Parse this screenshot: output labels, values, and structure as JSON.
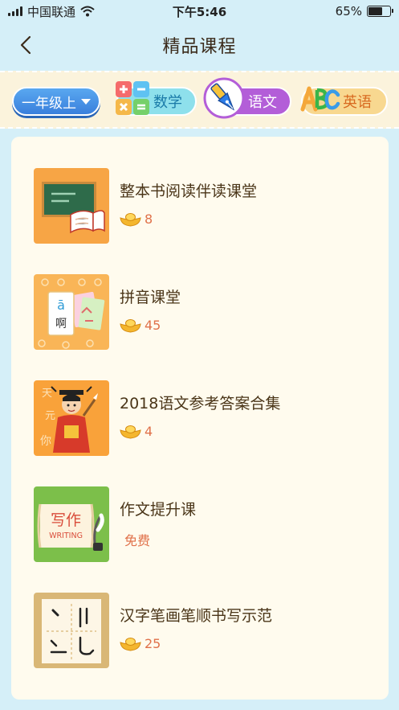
{
  "status_bar": {
    "carrier": "中国联通",
    "time": "下午5:46",
    "battery_percent": "65%",
    "battery_level": 0.65
  },
  "nav": {
    "title": "精品课程"
  },
  "subject_bar": {
    "grade": "一年级上",
    "tabs": [
      {
        "label": "数学",
        "icon": "math-symbols-icon",
        "selected": false
      },
      {
        "label": "语文",
        "icon": "fountain-pen-icon",
        "selected": true
      },
      {
        "label": "英语",
        "icon": "abc-letters-icon",
        "selected": false
      }
    ]
  },
  "courses": [
    {
      "title": "整本书阅读伴读课堂",
      "price": "8",
      "thumb": "blackboard-book"
    },
    {
      "title": "拼音课堂",
      "price": "45",
      "thumb": "pinyin-cards"
    },
    {
      "title": "2018语文参考答案合集",
      "price": "4",
      "thumb": "scholar"
    },
    {
      "title": "作文提升课",
      "price": "免费",
      "thumb": "writing-scroll"
    },
    {
      "title": "汉字笔画笔顺书写示范",
      "price": "25",
      "thumb": "character-grid"
    }
  ],
  "thumb_text": {
    "pinyin_letter": "ā",
    "pinyin_char": "啊",
    "writing_chars": "写作",
    "writing_en": "WRITING",
    "scholar_chars": [
      "天",
      "元",
      "你"
    ]
  },
  "colors": {
    "accent_purple": "#b35ed8",
    "price_orange": "#e0714a",
    "page_bg": "#d5eff8"
  }
}
